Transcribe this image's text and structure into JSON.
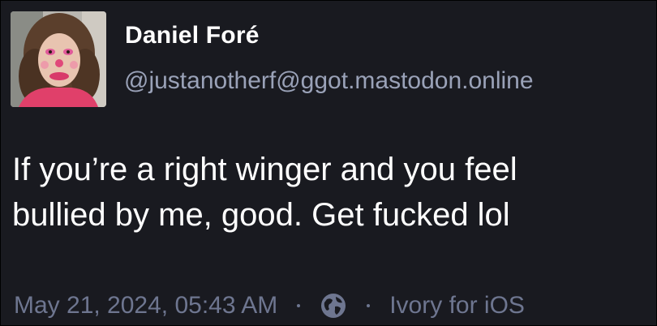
{
  "colors": {
    "background": "#191a20",
    "name": "#ffffff",
    "handle": "#9aa2b8",
    "body_text": "#ffffff",
    "meta": "#6e7690"
  },
  "author": {
    "display_name": "Daniel Foré",
    "handle": "@justanotherf@ggot.mastodon.online",
    "avatar_icon": "profile-photo"
  },
  "post": {
    "line1": "If you’re a right winger and you feel",
    "line2": "bullied by me, good. Get fucked lol"
  },
  "footer": {
    "timestamp": "May 21, 2024, 05:43 AM",
    "visibility_icon": "globe-icon",
    "client": "Ivory for iOS"
  }
}
